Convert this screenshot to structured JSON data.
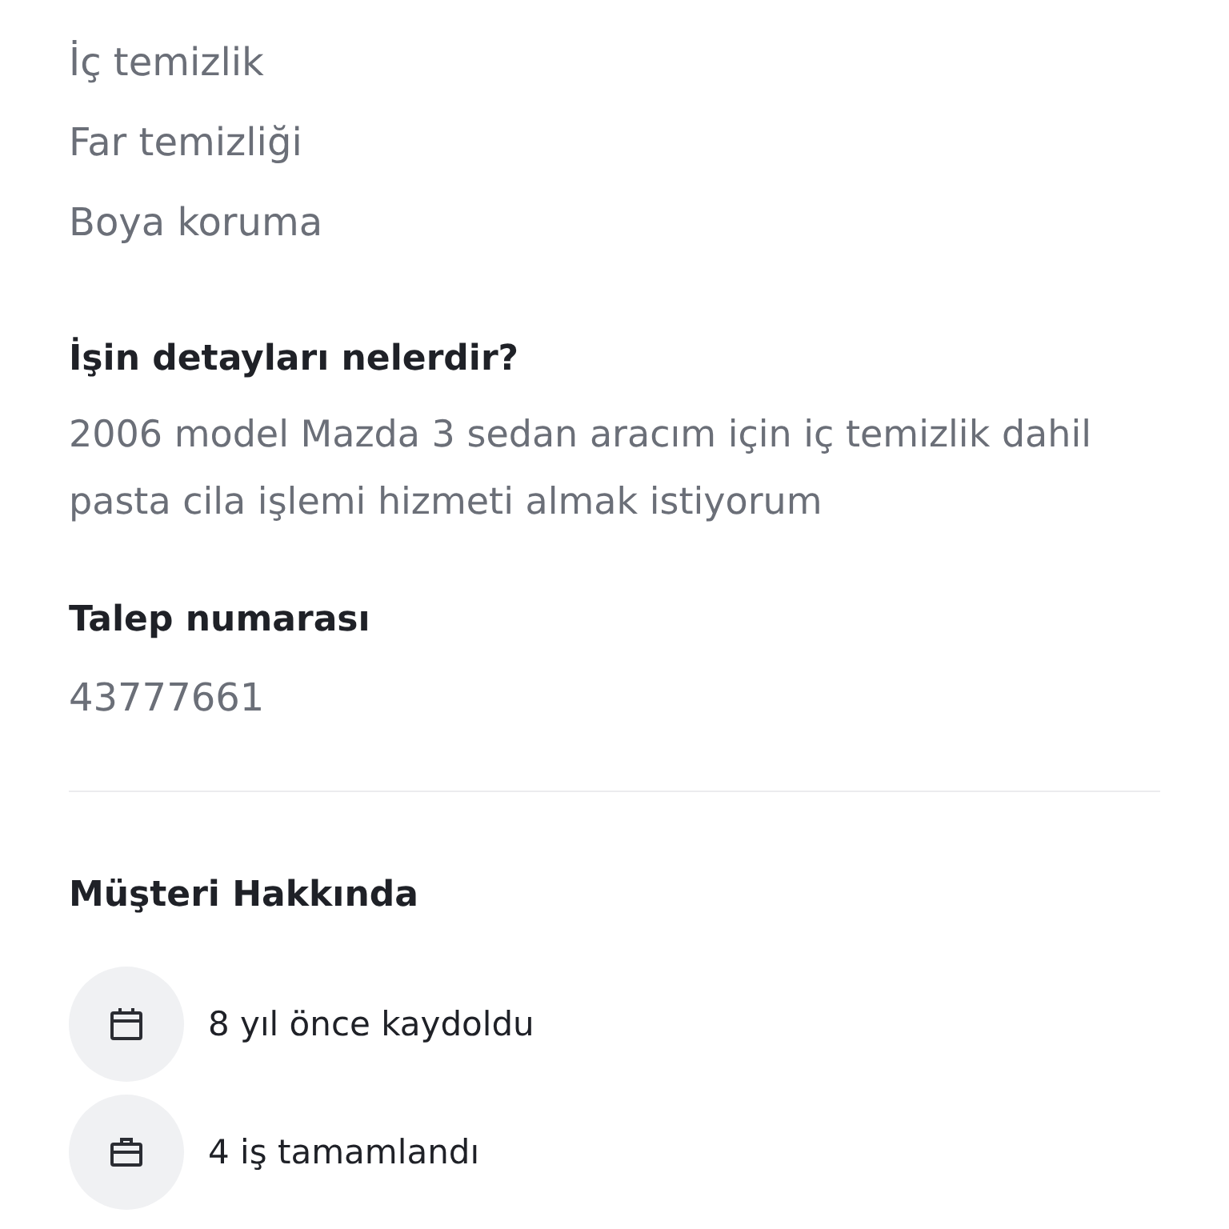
{
  "services": [
    "İç temizlik",
    "Far temizliği",
    "Boya koruma"
  ],
  "details": {
    "title": "İşin detayları nelerdir?",
    "text": "2006 model Mazda 3 sedan aracım için iç temizlik dahil pasta cila işlemi hizmeti almak istiyorum"
  },
  "request": {
    "title": "Talep numarası",
    "number": "43777661"
  },
  "customer": {
    "title": "Müşteri Hakkında",
    "facts": [
      {
        "kind": "calendar",
        "text": "8 yıl önce kaydoldu"
      },
      {
        "kind": "briefcase",
        "text": "4 iş tamamlandı"
      }
    ]
  }
}
